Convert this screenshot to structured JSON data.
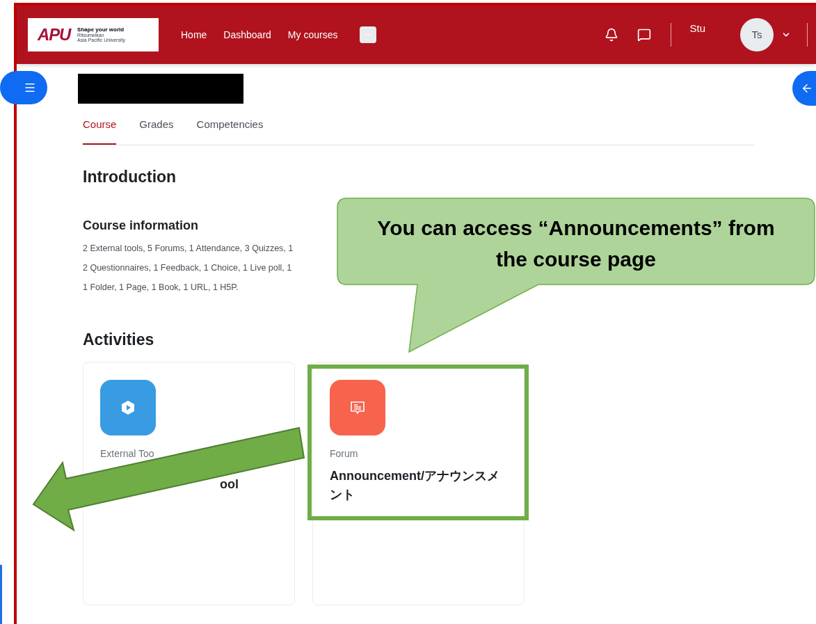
{
  "header": {
    "logo": {
      "wordmark": "APU",
      "tagline": "Shape your world",
      "name_line_1": "Ritsumeikan",
      "name_line_2": "Asia Pacific University"
    },
    "nav": [
      {
        "label": "Home"
      },
      {
        "label": "Dashboard"
      },
      {
        "label": "My courses"
      }
    ],
    "user": {
      "name": "Stu",
      "initials": "Ts"
    }
  },
  "tabs": [
    {
      "label": "Course",
      "selected": true
    },
    {
      "label": "Grades",
      "selected": false
    },
    {
      "label": "Competencies",
      "selected": false
    }
  ],
  "introduction": {
    "title": "Introduction",
    "info_title": "Course information",
    "info_lines": [
      "2 External tools, 5 Forums, 1 Attendance, 3 Quizzes, 1",
      "2 Questionnaires, 1 Feedback, 1 Choice, 1 Live poll, 1",
      "1 Folder, 1 Page, 1 Book, 1 URL, 1 H5P."
    ]
  },
  "activities": {
    "title": "Activities",
    "cards": [
      {
        "kind": "external_tool",
        "type_label": "External Too",
        "title": "ool",
        "highlighted": false
      },
      {
        "kind": "forum",
        "type_label": "Forum",
        "title": "Announcement/アナウンスメント",
        "highlighted": true
      }
    ]
  },
  "callout": {
    "text": "You can access “Announcements” from the course page"
  }
}
